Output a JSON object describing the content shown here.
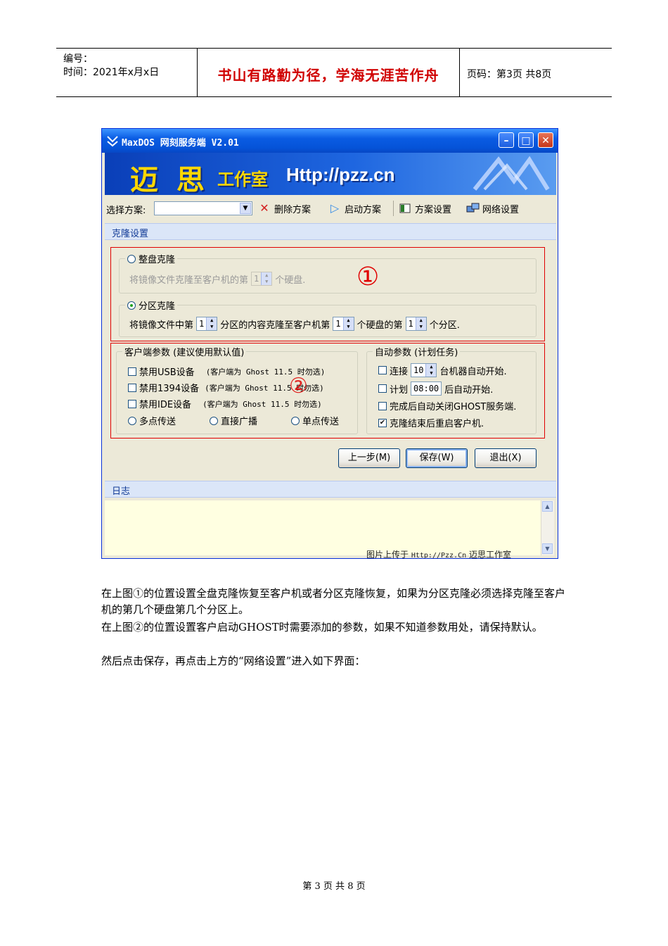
{
  "header": {
    "doc_no_label": "编号：",
    "time_label": "时间：2021年x月x日",
    "motto": "书山有路勤为径，学海无涯苦作舟",
    "page_label": "页码：第3页 共8页"
  },
  "window": {
    "title": "MaxDOS 网刻服务端 V2.01",
    "banner_brand": "迈 思",
    "banner_studio": "工作室",
    "banner_url": "Http://pzz.cn",
    "controls": {
      "minimize": "–",
      "maximize": "□",
      "close": "✕"
    }
  },
  "toolbar": {
    "select_label": "选择方案:",
    "delete_label": "删除方案",
    "start_label": "启动方案",
    "scheme_settings_label": "方案设置",
    "network_settings_label": "网络设置"
  },
  "clone_section": {
    "title": "克隆设置",
    "whole_disk": {
      "label": "整盘克隆",
      "text_before": "将镜像文件克隆至客户机的第",
      "value": "1",
      "text_after": "个硬盘.",
      "selected": false
    },
    "partition": {
      "label": "分区克隆",
      "text1": "将镜像文件中第",
      "value1": "1",
      "text2": "分区的内容克隆至客户机第",
      "value2": "1",
      "text3": "个硬盘的第",
      "value3": "1",
      "text4": "个分区.",
      "selected": true
    },
    "marker1": "①",
    "marker2": "②"
  },
  "client_params": {
    "title": "客户端参数 (建议使用默认值)",
    "items": [
      {
        "label": "禁用USB设备",
        "note": "(客户端为 Ghost 11.5 时勿选)",
        "checked": false
      },
      {
        "label": "禁用1394设备",
        "note": "(客户端为 Ghost 11.5 时勿选)",
        "checked": false
      },
      {
        "label": "禁用IDE设备",
        "note": "(客户端为 Ghost 11.5 时勿选)",
        "checked": false
      }
    ],
    "modes": [
      "多点传送",
      "直接广播",
      "单点传送"
    ]
  },
  "auto_params": {
    "title": "自动参数 (计划任务)",
    "connect_label": "连接",
    "connect_value": "10",
    "connect_after": "台机器自动开始.",
    "plan_label": "计划",
    "plan_value": "08:00",
    "plan_after": "后自动开始.",
    "close_after": "完成后自动关闭GHOST服务端.",
    "restart_after": "克隆结束后重启客户机.",
    "connect_checked": false,
    "plan_checked": false,
    "close_checked": false,
    "restart_checked": true
  },
  "buttons": {
    "prev": "上一步(M)",
    "save": "保存(W)",
    "exit": "退出(X)"
  },
  "log": {
    "title": "日志",
    "watermark_prefix": "图片上传于",
    "watermark_url": "Http://Pzz.Cn",
    "watermark_suffix": "迈思工作室"
  },
  "body": {
    "p1": "在上图①的位置设置全盘克隆恢复至客户机或者分区克隆恢复，如果为分区克隆必须选择克隆至客户机的第几个硬盘第几个分区上。",
    "p2": "在上图②的位置设置客户启动GHOST时需要添加的参数，如果不知道参数用处，请保持默认。",
    "p3": "然后点击保存，再点击上方的“网络设置”进入如下界面："
  },
  "footer": "第 3 页 共 8 页"
}
